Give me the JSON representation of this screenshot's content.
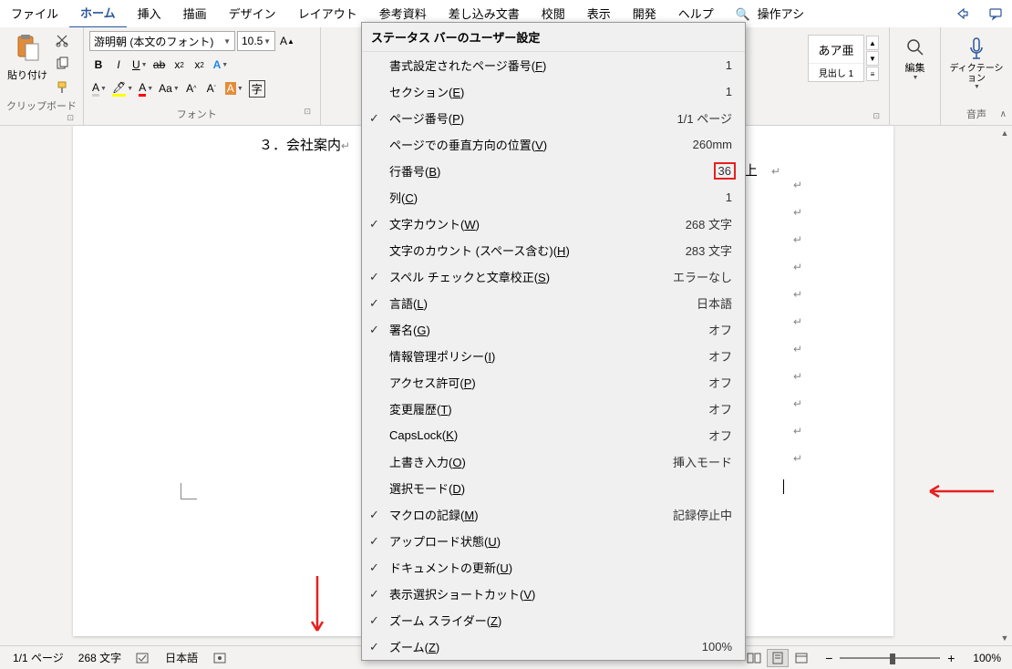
{
  "menu": {
    "items": [
      "ファイル",
      "ホーム",
      "挿入",
      "描画",
      "デザイン",
      "レイアウト",
      "参考資料",
      "差し込み文書",
      "校閲",
      "表示",
      "開発",
      "ヘルプ"
    ],
    "search": "操作アシ"
  },
  "ribbon": {
    "clipboard": {
      "paste": "貼り付け",
      "group_label": "クリップボード"
    },
    "font": {
      "name": "游明朝 (本文のフォント)",
      "size": "10.5",
      "group_label": "フォント"
    },
    "styles": {
      "preview": "あア亜",
      "name": "見出し 1"
    },
    "editing": {
      "label": "編集"
    },
    "dictation": {
      "label": "ディクテーション",
      "group_label": "音声"
    }
  },
  "document": {
    "line": "３．会社案内",
    "above": "以上"
  },
  "context": {
    "title": "ステータス バーのユーザー設定",
    "items": [
      {
        "checked": false,
        "label": "書式設定されたページ番号",
        "key": "F",
        "value": "1"
      },
      {
        "checked": false,
        "label": "セクション",
        "key": "E",
        "value": "1"
      },
      {
        "checked": true,
        "label": "ページ番号",
        "key": "P",
        "value": "1/1 ページ"
      },
      {
        "checked": false,
        "label": "ページでの垂直方向の位置",
        "key": "V",
        "value": "260mm"
      },
      {
        "checked": false,
        "label": "行番号",
        "key": "B",
        "value": "36",
        "highlight": true
      },
      {
        "checked": false,
        "label": "列",
        "key": "C",
        "value": "1"
      },
      {
        "checked": true,
        "label": "文字カウント",
        "key": "W",
        "value": "268 文字"
      },
      {
        "checked": false,
        "label": "文字のカウント (スペース含む)",
        "key": "H",
        "value": "283 文字"
      },
      {
        "checked": true,
        "label": "スペル チェックと文章校正",
        "key": "S",
        "value": "エラーなし"
      },
      {
        "checked": true,
        "label": "言語",
        "key": "L",
        "value": "日本語"
      },
      {
        "checked": true,
        "label": "署名",
        "key": "G",
        "value": "オフ"
      },
      {
        "checked": false,
        "label": "情報管理ポリシー",
        "key": "I",
        "value": "オフ"
      },
      {
        "checked": false,
        "label": "アクセス許可",
        "key": "P",
        "value": "オフ"
      },
      {
        "checked": false,
        "label": "変更履歴",
        "key": "T",
        "value": "オフ"
      },
      {
        "checked": false,
        "label": "CapsLock",
        "key": "K",
        "value": "オフ"
      },
      {
        "checked": false,
        "label": "上書き入力",
        "key": "O",
        "value": "挿入モード"
      },
      {
        "checked": false,
        "label": "選択モード",
        "key": "D",
        "value": ""
      },
      {
        "checked": true,
        "label": "マクロの記録",
        "key": "M",
        "value": "記録停止中"
      },
      {
        "checked": true,
        "label": "アップロード状態",
        "key": "U",
        "value": ""
      },
      {
        "checked": true,
        "label": "ドキュメントの更新",
        "key": "U",
        "value": ""
      },
      {
        "checked": true,
        "label": "表示選択ショートカット",
        "key": "V",
        "value": ""
      },
      {
        "checked": true,
        "label": "ズーム スライダー",
        "key": "Z",
        "value": ""
      },
      {
        "checked": true,
        "label": "ズーム",
        "key": "Z",
        "value": "100%"
      }
    ]
  },
  "status": {
    "page": "1/1 ページ",
    "words": "268 文字",
    "language": "日本語",
    "zoom": "100%"
  }
}
